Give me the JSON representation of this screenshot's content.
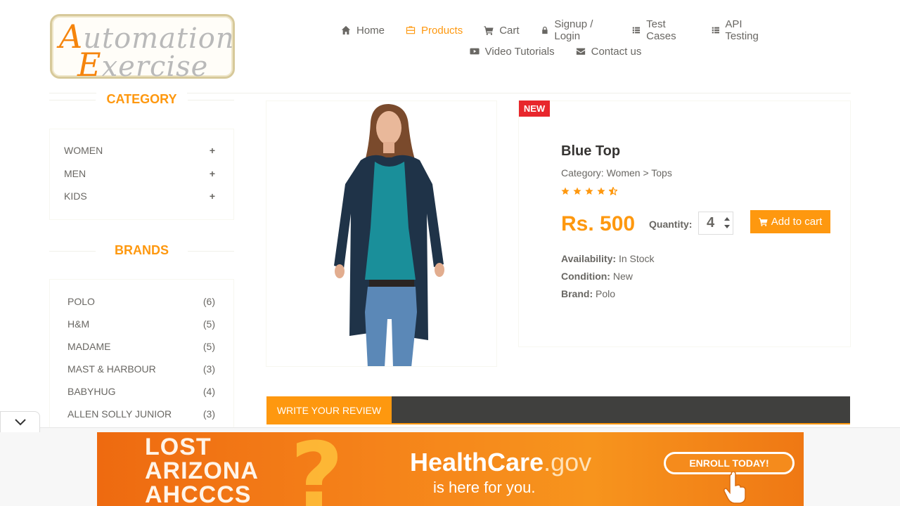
{
  "logo": {
    "line1_cap": "A",
    "line1_rest": "utomation",
    "line2_cap": "E",
    "line2_rest": "xercise"
  },
  "nav": {
    "items": [
      {
        "label": "Home",
        "icon": "home-icon"
      },
      {
        "label": "Products",
        "icon": "briefcase-icon",
        "active": true
      },
      {
        "label": "Cart",
        "icon": "cart-icon"
      },
      {
        "label": "Signup / Login",
        "icon": "lock-icon"
      },
      {
        "label": "Test Cases",
        "icon": "list-icon"
      },
      {
        "label": "API Testing",
        "icon": "list-icon"
      },
      {
        "label": "Video Tutorials",
        "icon": "youtube-play-icon"
      },
      {
        "label": "Contact us",
        "icon": "envelope-icon"
      }
    ]
  },
  "sidebar": {
    "category_title": "CATEGORY",
    "categories": [
      {
        "label": "WOMEN",
        "toggle": "+"
      },
      {
        "label": "MEN",
        "toggle": "+"
      },
      {
        "label": "KIDS",
        "toggle": "+"
      }
    ],
    "brands_title": "BRANDS",
    "brands": [
      {
        "name": "POLO",
        "count": "(6)"
      },
      {
        "name": "H&M",
        "count": "(5)"
      },
      {
        "name": "MADAME",
        "count": "(5)"
      },
      {
        "name": "MAST & HARBOUR",
        "count": "(3)"
      },
      {
        "name": "BABYHUG",
        "count": "(4)"
      },
      {
        "name": "ALLEN SOLLY JUNIOR",
        "count": "(3)"
      }
    ]
  },
  "product": {
    "badge": "NEW",
    "name": "Blue Top",
    "category": "Category: Women > Tops",
    "rating": 4.5,
    "price": "Rs. 500",
    "quantity_label": "Quantity:",
    "quantity": "4",
    "add_to_cart": "Add to cart",
    "availability_label": "Availability:",
    "availability": "In Stock",
    "condition_label": "Condition:",
    "condition": "New",
    "brand_label": "Brand:",
    "brand": "Polo"
  },
  "review": {
    "tab_label": "WRITE YOUR REVIEW"
  },
  "ad": {
    "left_text": "LOST\nARIZONA\nAHCCCS",
    "brand": "HealthCare",
    "brand_suffix": ".gov",
    "tagline": "is here for you.",
    "cta": "ENROLL TODAY!"
  },
  "colors": {
    "accent": "#fe980f",
    "badge": "#e8262c",
    "review_bar": "#40403e",
    "text": "#696763"
  }
}
